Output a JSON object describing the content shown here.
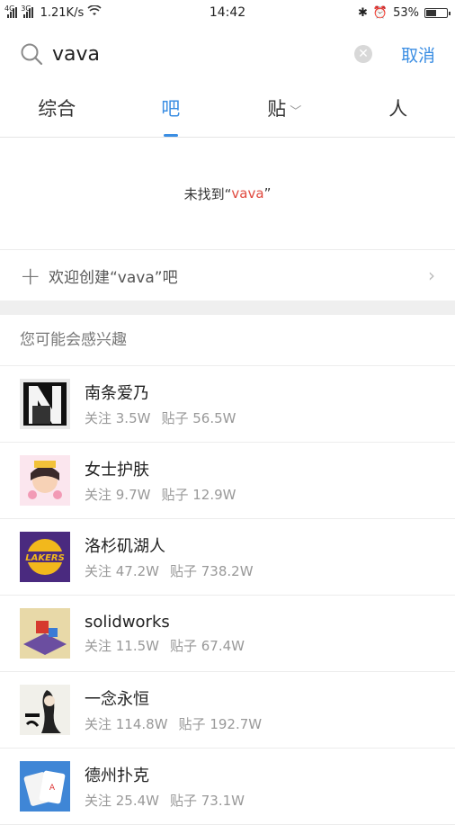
{
  "status_bar": {
    "network_label": "4G",
    "network_label2": "3G",
    "speed": "1.21K/s",
    "time": "14:42",
    "battery_percent": "53%",
    "battery_level": 0.53
  },
  "search": {
    "query": "vava",
    "cancel_label": "取消"
  },
  "tabs": [
    {
      "label": "综合",
      "active": false
    },
    {
      "label": "吧",
      "active": true
    },
    {
      "label": "贴",
      "active": false
    },
    {
      "label": "人",
      "active": false
    }
  ],
  "empty_state": {
    "prefix": "未找到“",
    "keyword": "vava",
    "suffix": "”"
  },
  "create": {
    "label": "欢迎创建“vava”吧"
  },
  "suggestions": {
    "title": "您可能会感兴趣",
    "items": [
      {
        "name": "南条爱乃",
        "follow": "关注 3.5W",
        "posts": "贴子 56.5W",
        "avatar_color": "#111111"
      },
      {
        "name": "女士护肤",
        "follow": "关注 9.7W",
        "posts": "贴子 12.9W",
        "avatar_color": "#f3b6c8"
      },
      {
        "name": "洛杉矶湖人",
        "follow": "关注 47.2W",
        "posts": "贴子 738.2W",
        "avatar_color": "#4a2a7f"
      },
      {
        "name": "solidworks",
        "follow": "关注 11.5W",
        "posts": "贴子 67.4W",
        "avatar_color": "#c8a35a"
      },
      {
        "name": "一念永恒",
        "follow": "关注 114.8W",
        "posts": "贴子 192.7W",
        "avatar_color": "#e8e8e0"
      },
      {
        "name": "德州扑克",
        "follow": "关注 25.4W",
        "posts": "贴子 73.1W",
        "avatar_color": "#3f86d6"
      }
    ]
  }
}
